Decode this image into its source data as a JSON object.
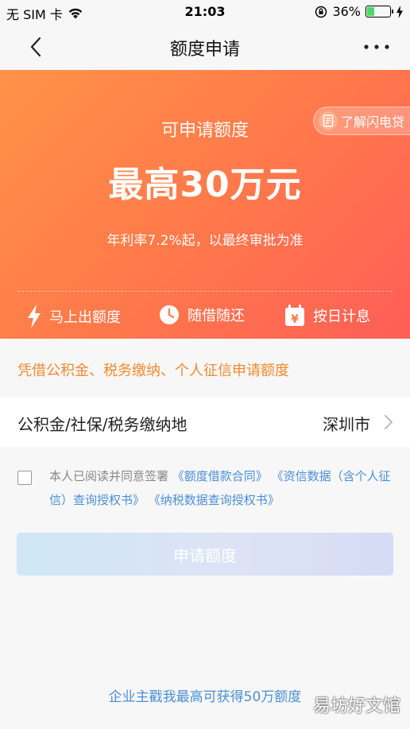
{
  "status_bar": {
    "carrier": "无 SIM 卡",
    "time": "21:03",
    "battery_percent_text": "36%",
    "battery_level": 0.36
  },
  "nav": {
    "title": "额度申请",
    "back_icon": "chevron-left-icon",
    "more_icon": "ellipsis-icon"
  },
  "hero": {
    "label": "可申请额度",
    "amount": "最高30万元",
    "rate": "年利率7.2%起，以最终审批为准",
    "learn_badge": "了解闪电贷",
    "features": [
      {
        "icon": "lightning-icon",
        "label": "马上出额度"
      },
      {
        "icon": "clock-icon",
        "label": "随借随还"
      },
      {
        "icon": "calendar-yen-icon",
        "label": "按日计息"
      }
    ],
    "colors": {
      "start": "#ff9248",
      "end": "#ff5e57"
    }
  },
  "tip": "凭借公积金、税务缴纳、个人征信申请额度",
  "location": {
    "label": "公积金/社保/税务缴纳地",
    "value": "深圳市"
  },
  "agreement": {
    "prefix": "本人已阅读并同意签署",
    "links": [
      "《额度借款合同》",
      "《资信数据（含个人征信）查询授权书》",
      "《纳税数据查询授权书》"
    ],
    "checked": false
  },
  "apply_button": "申请额度",
  "footer_link": "企业主戳我最高可获得50万额度",
  "watermark": "易坊好文馆",
  "colors": {
    "accent_orange": "#f08a2f",
    "link_blue": "#4a8fd6"
  }
}
